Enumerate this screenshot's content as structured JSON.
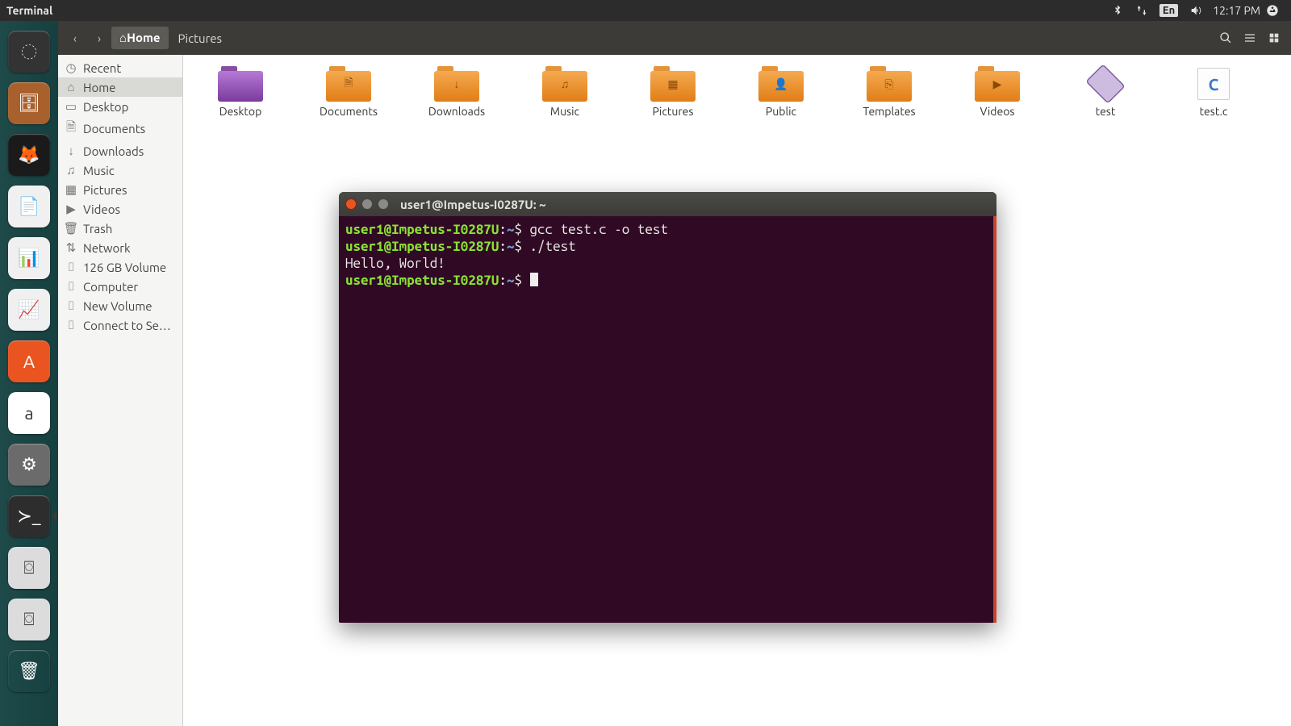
{
  "topbar": {
    "app_title": "Terminal",
    "language": "En",
    "clock": "12:17 PM"
  },
  "launcher": {
    "items": [
      {
        "name": "dash",
        "bg": "#333",
        "glyph": "◌"
      },
      {
        "name": "files",
        "bg": "#a8602d",
        "glyph": "🗄"
      },
      {
        "name": "firefox",
        "bg": "#1a1a1a",
        "glyph": "🦊"
      },
      {
        "name": "writer",
        "bg": "#f0f0f0",
        "glyph": "📄"
      },
      {
        "name": "calc",
        "bg": "#f0f0f0",
        "glyph": "📊"
      },
      {
        "name": "impress",
        "bg": "#f0f0f0",
        "glyph": "📈"
      },
      {
        "name": "software",
        "bg": "#e95420",
        "glyph": "A"
      },
      {
        "name": "amazon",
        "bg": "#ffffff",
        "glyph": "a"
      },
      {
        "name": "settings",
        "bg": "#6b6b6b",
        "glyph": "⚙"
      },
      {
        "name": "terminal",
        "bg": "#2d2d2d",
        "glyph": "≻_"
      },
      {
        "name": "drive1",
        "bg": "#dcdcdc",
        "glyph": "⌼"
      },
      {
        "name": "drive2",
        "bg": "#dcdcdc",
        "glyph": "⌼"
      },
      {
        "name": "trash",
        "bg": "transparent",
        "glyph": "🗑"
      }
    ]
  },
  "fm": {
    "path_home": "Home",
    "path_pictures": "Pictures",
    "sidebar": [
      {
        "icon": "◷",
        "label": "Recent"
      },
      {
        "icon": "⌂",
        "label": "Home",
        "selected": true
      },
      {
        "icon": "▭",
        "label": "Desktop"
      },
      {
        "icon": "🗎",
        "label": "Documents"
      },
      {
        "icon": "↓",
        "label": "Downloads"
      },
      {
        "icon": "♫",
        "label": "Music"
      },
      {
        "icon": "▦",
        "label": "Pictures"
      },
      {
        "icon": "▶",
        "label": "Videos"
      },
      {
        "icon": "🗑",
        "label": "Trash"
      },
      {
        "icon": "⇅",
        "label": "Network"
      },
      {
        "icon": "⌷",
        "label": "126 GB Volume"
      },
      {
        "icon": "⌷",
        "label": "Computer"
      },
      {
        "icon": "⌷",
        "label": "New Volume"
      },
      {
        "icon": "⌷",
        "label": "Connect to Se…"
      }
    ],
    "items": [
      {
        "type": "folder-purple",
        "label": "Desktop"
      },
      {
        "type": "folder",
        "label": "Documents",
        "glyph": "🗎"
      },
      {
        "type": "folder",
        "label": "Downloads",
        "glyph": "↓"
      },
      {
        "type": "folder",
        "label": "Music",
        "glyph": "♫"
      },
      {
        "type": "folder",
        "label": "Pictures",
        "glyph": "▦"
      },
      {
        "type": "folder",
        "label": "Public",
        "glyph": "👤"
      },
      {
        "type": "folder",
        "label": "Templates",
        "glyph": "⎘"
      },
      {
        "type": "folder",
        "label": "Videos",
        "glyph": "▶"
      },
      {
        "type": "file-bin",
        "label": "test"
      },
      {
        "type": "file-c",
        "label": "test.c"
      }
    ]
  },
  "terminal": {
    "window_title": "user1@Impetus-I0287U: ~",
    "prompt_user": "user1@Impetus-I0287U",
    "prompt_path": "~",
    "prompt_sym": "$",
    "lines": [
      {
        "cmd": "gcc test.c -o test"
      },
      {
        "cmd": "./test"
      },
      {
        "out": "Hello, World!"
      }
    ]
  }
}
